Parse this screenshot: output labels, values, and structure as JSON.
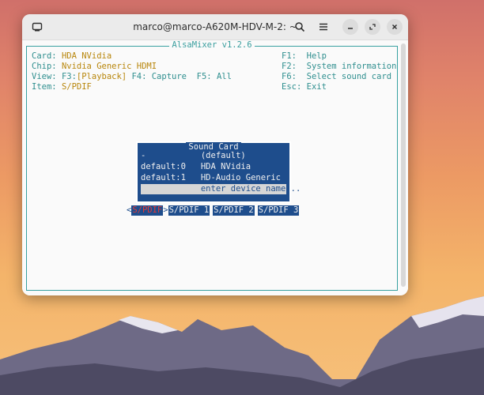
{
  "window": {
    "title": "marco@marco-A620M-HDV-M-2: ~",
    "app_title": "AlsaMixer v1.2.6"
  },
  "info": {
    "card_label": "Card:",
    "card_value": "HDA NVidia",
    "chip_label": "Chip:",
    "chip_value": "Nvidia Generic HDMI",
    "view_label": "View:",
    "view_f3": "F3:",
    "view_playback": "[Playback]",
    "view_f4": "F4: Capture",
    "view_f5": "F5: All",
    "item_label": "Item:",
    "item_value": "S/PDIF"
  },
  "keys": {
    "f1_key": "F1:",
    "f1_label": "Help",
    "f2_key": "F2:",
    "f2_label": "System information",
    "f6_key": "F6:",
    "f6_label": "Select sound card",
    "esc_key": "Esc:",
    "esc_label": "Exit"
  },
  "dialog": {
    "title": "Sound Card",
    "rows": [
      {
        "text": "-           (default)"
      },
      {
        "text": "default:0   HDA NVidia"
      },
      {
        "text": "default:1   HD-Audio Generic"
      },
      {
        "text": "            enter device name..."
      }
    ]
  },
  "tabs": {
    "left_arrow": "<",
    "right_arrow": ">",
    "items": [
      "S/PDIF",
      "S/PDIF 1",
      "S/PDIF 2",
      "S/PDIF 3"
    ]
  },
  "colors": {
    "frame": "#38a0a0",
    "dialog_bg": "#1e4d8c",
    "active_tab": "#e03a3a",
    "value_gold": "#b8860b"
  }
}
